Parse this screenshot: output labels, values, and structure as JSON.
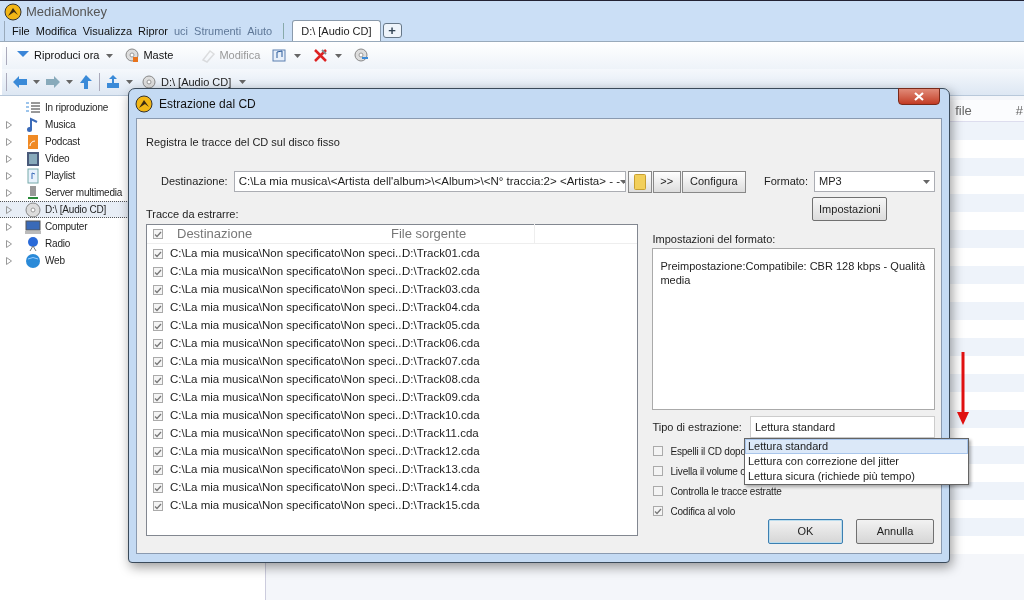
{
  "app": {
    "title": "MediaMonkey",
    "menu": [
      {
        "label": "File",
        "dimmed": false
      },
      {
        "label": "Modifica",
        "dimmed": false
      },
      {
        "label": "Visualizza",
        "dimmed": false
      },
      {
        "label": "Ripror",
        "dimmed": false
      },
      {
        "label": "uci",
        "dimmed": true
      },
      {
        "label": "Strumenti",
        "dimmed": true
      },
      {
        "label": "Aiuto",
        "dimmed": true
      }
    ],
    "tab": {
      "label": "D:\\ [Audio CD]",
      "add": "+"
    },
    "toolbar": [
      {
        "kind": "play",
        "label": "Riproduci ora",
        "disabled": false,
        "dropdown": true
      },
      {
        "kind": "master",
        "label": "Maste",
        "disabled": false,
        "dropdown": false
      },
      {
        "kind": "edit",
        "label": "Modifica",
        "disabled": true,
        "dropdown": false
      },
      {
        "kind": "send",
        "disabled": false,
        "dropdown": true
      },
      {
        "kind": "tools",
        "disabled": false,
        "dropdown": true
      },
      {
        "kind": "rip",
        "disabled": false,
        "dropdown": false
      }
    ],
    "location": "D:\\ [Audio CD]",
    "sidebar": [
      {
        "label": "In riproduzione",
        "kind": "nowplaying",
        "expandable": false,
        "selected": false
      },
      {
        "label": "Musica",
        "kind": "music",
        "expandable": true,
        "selected": false
      },
      {
        "label": "Podcast",
        "kind": "podcast",
        "expandable": true,
        "selected": false
      },
      {
        "label": "Video",
        "kind": "video",
        "expandable": true,
        "selected": false
      },
      {
        "label": "Playlist",
        "kind": "playlist",
        "expandable": true,
        "selected": false
      },
      {
        "label": "Server multimedia",
        "kind": "server",
        "expandable": true,
        "selected": false
      },
      {
        "label": "D:\\ [Audio CD]",
        "kind": "cd",
        "expandable": true,
        "selected": true
      },
      {
        "label": "Computer",
        "kind": "computer",
        "expandable": true,
        "selected": false
      },
      {
        "label": "Radio",
        "kind": "radio",
        "expandable": true,
        "selected": false
      },
      {
        "label": "Web",
        "kind": "web",
        "expandable": true,
        "selected": false
      }
    ],
    "columns": [
      "file",
      "#"
    ]
  },
  "dialog": {
    "title": "Estrazione dal CD",
    "intro": "Registra le tracce del CD sul disco fisso",
    "destination_label": "Destinazione:",
    "destination_value": "C:\\La mia musica\\<Artista dell'album>\\<Album>\\<N° traccia:2> <Artista> - -",
    "more_button": ">>",
    "configure_button": "Configura",
    "format_label": "Formato:",
    "format_value": "MP3",
    "settings_button": "Impostazioni",
    "tracks_label": "Tracce da estrarre:",
    "track_columns": [
      "Destinazione",
      "File sorgente"
    ],
    "all_checked": true,
    "tracks": [
      {
        "destination": "C:\\La mia musica\\Non specificato\\Non speci...",
        "source": "D:\\Track01.cda",
        "checked": true
      },
      {
        "destination": "C:\\La mia musica\\Non specificato\\Non speci...",
        "source": "D:\\Track02.cda",
        "checked": true
      },
      {
        "destination": "C:\\La mia musica\\Non specificato\\Non speci...",
        "source": "D:\\Track03.cda",
        "checked": true
      },
      {
        "destination": "C:\\La mia musica\\Non specificato\\Non speci...",
        "source": "D:\\Track04.cda",
        "checked": true
      },
      {
        "destination": "C:\\La mia musica\\Non specificato\\Non speci...",
        "source": "D:\\Track05.cda",
        "checked": true
      },
      {
        "destination": "C:\\La mia musica\\Non specificato\\Non speci...",
        "source": "D:\\Track06.cda",
        "checked": true
      },
      {
        "destination": "C:\\La mia musica\\Non specificato\\Non speci...",
        "source": "D:\\Track07.cda",
        "checked": true
      },
      {
        "destination": "C:\\La mia musica\\Non specificato\\Non speci...",
        "source": "D:\\Track08.cda",
        "checked": true
      },
      {
        "destination": "C:\\La mia musica\\Non specificato\\Non speci...",
        "source": "D:\\Track09.cda",
        "checked": true
      },
      {
        "destination": "C:\\La mia musica\\Non specificato\\Non speci...",
        "source": "D:\\Track10.cda",
        "checked": true
      },
      {
        "destination": "C:\\La mia musica\\Non specificato\\Non speci...",
        "source": "D:\\Track11.cda",
        "checked": true
      },
      {
        "destination": "C:\\La mia musica\\Non specificato\\Non speci...",
        "source": "D:\\Track12.cda",
        "checked": true
      },
      {
        "destination": "C:\\La mia musica\\Non specificato\\Non speci...",
        "source": "D:\\Track13.cda",
        "checked": true
      },
      {
        "destination": "C:\\La mia musica\\Non specificato\\Non speci...",
        "source": "D:\\Track14.cda",
        "checked": true
      },
      {
        "destination": "C:\\La mia musica\\Non specificato\\Non speci...",
        "source": "D:\\Track15.cda",
        "checked": true
      }
    ],
    "format_settings_label": "Impostazioni del formato:",
    "format_settings_text": "Preimpostazione:Compatibile: CBR 128 kbps - Qualità media",
    "extraction_label": "Tipo di estrazione:",
    "extraction_value": "Lettura standard",
    "extraction_options": [
      {
        "label": "Lettura standard",
        "selected": true
      },
      {
        "label": "Lettura con correzione del jitter",
        "selected": false
      },
      {
        "label": "Lettura sicura (richiede più tempo)",
        "selected": false
      }
    ],
    "options": [
      {
        "label": "Espelli il CD dopo",
        "checked": false
      },
      {
        "label": "Livella il volume c",
        "checked": false
      },
      {
        "label": "Controlla le tracce estratte",
        "checked": false
      },
      {
        "label": "Codifica al volo",
        "checked": true
      }
    ],
    "ok_button": "OK",
    "cancel_button": "Annulla"
  }
}
